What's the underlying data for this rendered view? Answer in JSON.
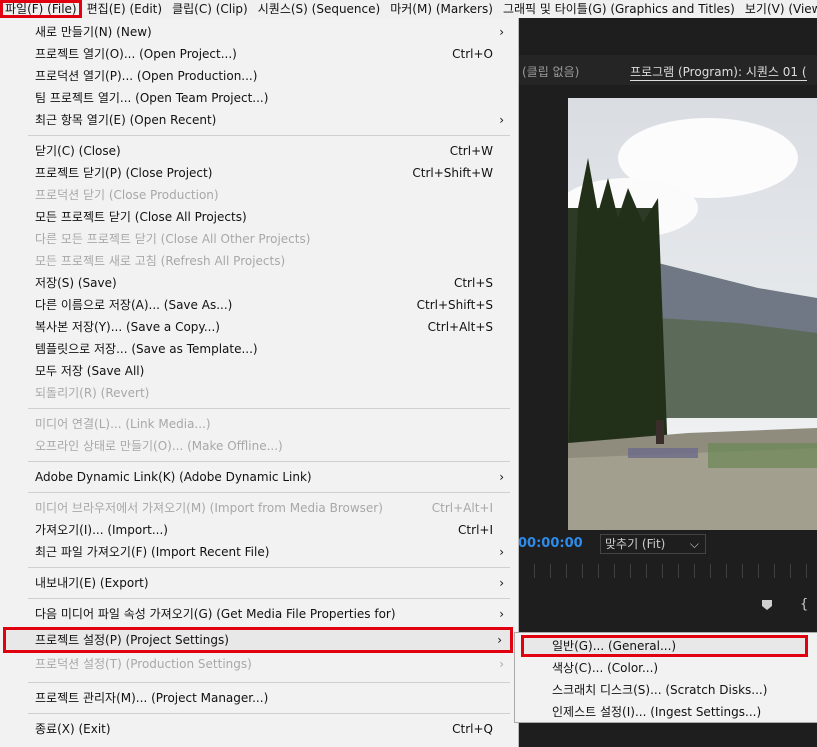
{
  "menubar": [
    {
      "label": "파일(F) (File)"
    },
    {
      "label": "편집(E) (Edit)"
    },
    {
      "label": "클립(C) (Clip)"
    },
    {
      "label": "시퀀스(S) (Sequence)"
    },
    {
      "label": "마커(M) (Markers)"
    },
    {
      "label": "그래픽 및 타이틀(G) (Graphics and Titles)"
    },
    {
      "label": "보기(V) (View)"
    }
  ],
  "program": {
    "clip_none": "(클립 없음)",
    "title": "프로그램 (Program): 시퀀스 01 (",
    "timecode": "00:00:00",
    "fit_label": "맞추기 (Fit)",
    "fit_icon": "chevron-down-icon"
  },
  "file_menu": [
    {
      "label": "새로 만들기(N) (New)",
      "shortcut": "",
      "arrow": "›"
    },
    {
      "label": "프로젝트 열기(O)... (Open Project...)",
      "shortcut": "Ctrl+O",
      "arrow": ""
    },
    {
      "label": "프로덕션 열기(P)... (Open Production...)",
      "shortcut": "",
      "arrow": ""
    },
    {
      "label": "팀 프로젝트 열기... (Open Team Project...)",
      "shortcut": "",
      "arrow": ""
    },
    {
      "label": "최근 항목 열기(E) (Open Recent)",
      "shortcut": "",
      "arrow": "›"
    },
    {
      "label": "닫기(C) (Close)",
      "shortcut": "Ctrl+W",
      "arrow": ""
    },
    {
      "label": "프로젝트 닫기(P) (Close Project)",
      "shortcut": "Ctrl+Shift+W",
      "arrow": ""
    },
    {
      "label": "프로덕션 닫기 (Close Production)",
      "shortcut": "",
      "arrow": ""
    },
    {
      "label": "모든 프로젝트 닫기 (Close All Projects)",
      "shortcut": "",
      "arrow": ""
    },
    {
      "label": "다른 모든 프로젝트 닫기 (Close All Other Projects)",
      "shortcut": "",
      "arrow": ""
    },
    {
      "label": "모든 프로젝트 새로 고침 (Refresh All Projects)",
      "shortcut": "",
      "arrow": ""
    },
    {
      "label": "저장(S) (Save)",
      "shortcut": "Ctrl+S",
      "arrow": ""
    },
    {
      "label": "다른 이름으로 저장(A)... (Save As...)",
      "shortcut": "Ctrl+Shift+S",
      "arrow": ""
    },
    {
      "label": "복사본 저장(Y)... (Save a Copy...)",
      "shortcut": "Ctrl+Alt+S",
      "arrow": ""
    },
    {
      "label": "템플릿으로 저장... (Save as Template...)",
      "shortcut": "",
      "arrow": ""
    },
    {
      "label": "모두 저장 (Save All)",
      "shortcut": "",
      "arrow": ""
    },
    {
      "label": "되돌리기(R) (Revert)",
      "shortcut": "",
      "arrow": ""
    },
    {
      "label": "미디어 연결(L)... (Link Media...)",
      "shortcut": "",
      "arrow": ""
    },
    {
      "label": "오프라인 상태로 만들기(O)... (Make Offline...)",
      "shortcut": "",
      "arrow": ""
    },
    {
      "label": "Adobe Dynamic Link(K) (Adobe Dynamic Link)",
      "shortcut": "",
      "arrow": "›"
    },
    {
      "label": "미디어 브라우저에서 가져오기(M) (Import from Media Browser)",
      "shortcut": "Ctrl+Alt+I",
      "arrow": ""
    },
    {
      "label": "가져오기(I)... (Import...)",
      "shortcut": "Ctrl+I",
      "arrow": ""
    },
    {
      "label": "최근 파일 가져오기(F) (Import Recent File)",
      "shortcut": "",
      "arrow": "›"
    },
    {
      "label": "내보내기(E) (Export)",
      "shortcut": "",
      "arrow": "›"
    },
    {
      "label": "다음 미디어 파일 속성 가져오기(G) (Get Media File Properties for)",
      "shortcut": "",
      "arrow": "›"
    },
    {
      "label": "프로젝트 설정(P) (Project Settings)",
      "shortcut": "",
      "arrow": "›"
    },
    {
      "label": "프로덕션 설정(T) (Production Settings)",
      "shortcut": "",
      "arrow": "›"
    },
    {
      "label": "프로젝트 관리자(M)... (Project Manager...)",
      "shortcut": "",
      "arrow": ""
    },
    {
      "label": "종료(X) (Exit)",
      "shortcut": "Ctrl+Q",
      "arrow": ""
    }
  ],
  "project_settings_submenu": [
    {
      "label": "일반(G)... (General...)"
    },
    {
      "label": "색상(C)... (Color...)"
    },
    {
      "label": "스크래치 디스크(S)... (Scratch Disks...)"
    },
    {
      "label": "인제스트 설정(I)... (Ingest Settings...)"
    }
  ]
}
